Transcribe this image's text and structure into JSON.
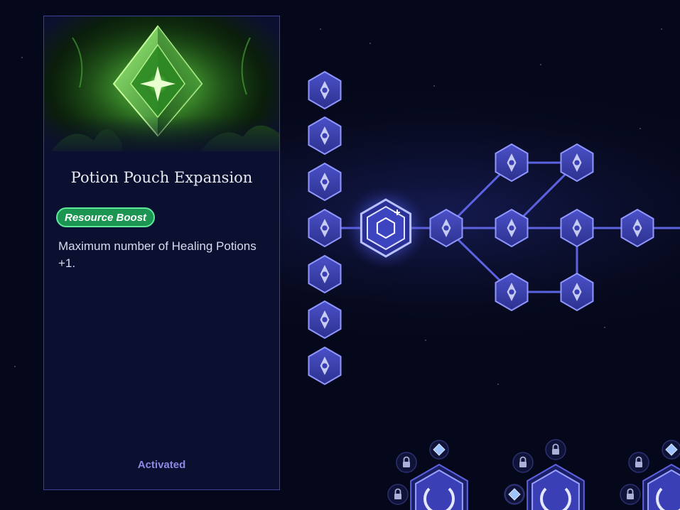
{
  "card": {
    "title": "Potion Pouch Expansion",
    "badge": "Resource Boost",
    "description": "Maximum number of Healing Potions +1.",
    "status": "Activated",
    "image_icon": "green-crystal-gem-icon"
  },
  "colors": {
    "background": "#070a1e",
    "card_border": "#3c4296",
    "badge_fill": "#1d9552",
    "badge_border": "#5ee89a",
    "node_fill": "#3a3fb5",
    "node_border": "#8f97ff",
    "link": "#5d63e0",
    "status_text": "#8e88e4"
  },
  "tree": {
    "column_nodes": [
      {
        "icon": "chalice-icon"
      },
      {
        "icon": "armor-icon"
      },
      {
        "icon": "dash-runner-icon"
      },
      {
        "icon": "wing-claw-icon"
      },
      {
        "icon": "crescent-slash-icon"
      },
      {
        "icon": "sprint-runner-icon"
      },
      {
        "icon": "swirl-slash-icon"
      }
    ],
    "selected_node": {
      "icon": "cube-plus-icon",
      "state": "selected"
    },
    "graph_nodes": [
      {
        "icon": "mountain-peak-icon"
      },
      {
        "icon": "ring-portal-icon"
      },
      {
        "icon": "vortex-icon"
      },
      {
        "icon": "warrior-statue-icon"
      },
      {
        "icon": "starburst-icon"
      },
      {
        "icon": "winged-figure-icon"
      },
      {
        "icon": "fountain-icon"
      },
      {
        "icon": "dragon-head-icon"
      }
    ],
    "bottom_skills": [
      {
        "icon": "crescent-moon-icon",
        "locks": 2,
        "mini_icon": "swap-arrows-icon"
      },
      {
        "icon": "tower-icon",
        "locks": 2,
        "mini_icon": "diamond-icon"
      },
      {
        "icon": "vortex-eye-icon",
        "locks": 2,
        "mini_icon": "info-diamond-icon"
      }
    ]
  }
}
